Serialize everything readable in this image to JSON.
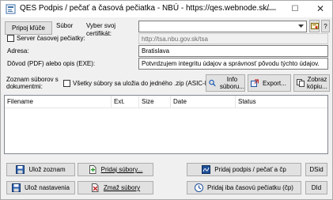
{
  "window": {
    "title": "QES Podpis / pečať a časová pečiatka - NBÚ - https://qes.webnode.sk/",
    "minimize": "—",
    "maximize": "☐",
    "close": "✕"
  },
  "top": {
    "connect_button": "Pripoj kľúče",
    "subor_label": "Súbor",
    "cert_label": "Vyber svoj certifikát:",
    "cert_value": "",
    "help_button": "?",
    "tsa_checkbox_label": "Server časovej pečiatky:",
    "tsa_url": "http://tsa.nbu.gov.sk/tsa",
    "address_label": "Adresa:",
    "address_value": "Bratislava",
    "reason_label": "Dôvod (PDF) alebo opis (EXE):",
    "reason_value": "Potvrdzujem integritu údajov a správnosť pôvodu týchto údajov."
  },
  "files": {
    "list_label_line1": "Zoznam súborov s",
    "list_label_line2": "dokumentmi:",
    "zip_checkbox_label": "Všetky súbory sa uložia do jedného .zip (ASIC-E)",
    "info_button_line1": "Info",
    "info_button_line2": "súboru...",
    "export_button": "Export...",
    "show_copy_line1": "Zobraz",
    "show_copy_line2": "kópiu...",
    "columns": [
      "Filename",
      "Ext.",
      "Size",
      "Date",
      "Status"
    ]
  },
  "actions": {
    "save_list": "Ulož zoznam",
    "add_files": "Pridaj súbory...",
    "sign_seal": "Pridaj podpis / pečať a čp",
    "dsid": "DSid",
    "save_settings": "Ulož nastavenia",
    "delete_files": "Zmaž súbory",
    "add_timestamp": "Pridaj iba časovú pečiatku (čp)",
    "did": "DId"
  }
}
